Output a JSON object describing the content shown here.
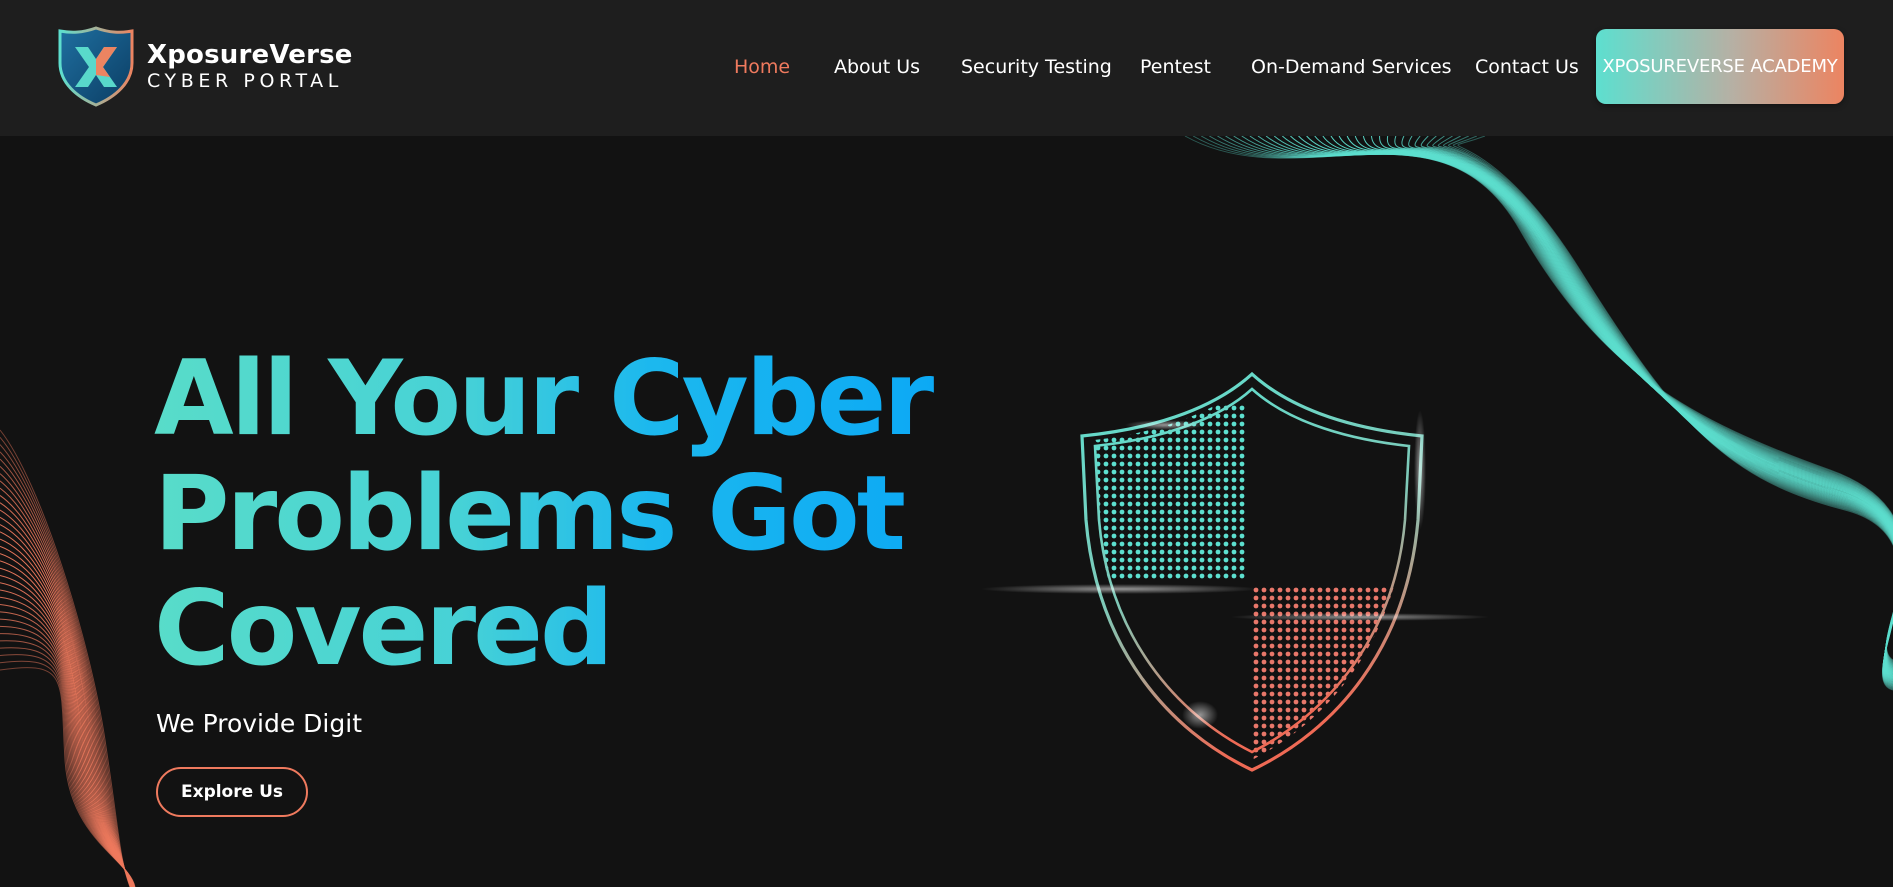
{
  "brand": {
    "name": "XposureVerse",
    "tagline": "CYBER PORTAL",
    "logo_icon": "xv-shield-logo"
  },
  "nav": {
    "items": [
      {
        "label": "Home",
        "active": true
      },
      {
        "label": "About Us",
        "active": false
      },
      {
        "label": "Security Testing",
        "active": false
      },
      {
        "label": "Pentest",
        "active": false
      },
      {
        "label": "On-Demand Services",
        "active": false
      },
      {
        "label": "Contact Us",
        "active": false
      }
    ],
    "cta_label": "XPOSUREVERSE ACADEMY"
  },
  "hero": {
    "title": "All Your Cyber Problems Got Covered",
    "subtitle": "We Provide Digit",
    "button_label": "Explore Us",
    "illustration": "cyber-shield-icon"
  },
  "colors": {
    "background": "#121212",
    "header": "#1e1e1e",
    "accent_orange": "#ef7a5e",
    "accent_teal": "#5ddfcf",
    "accent_blue": "#0ba8f5"
  }
}
